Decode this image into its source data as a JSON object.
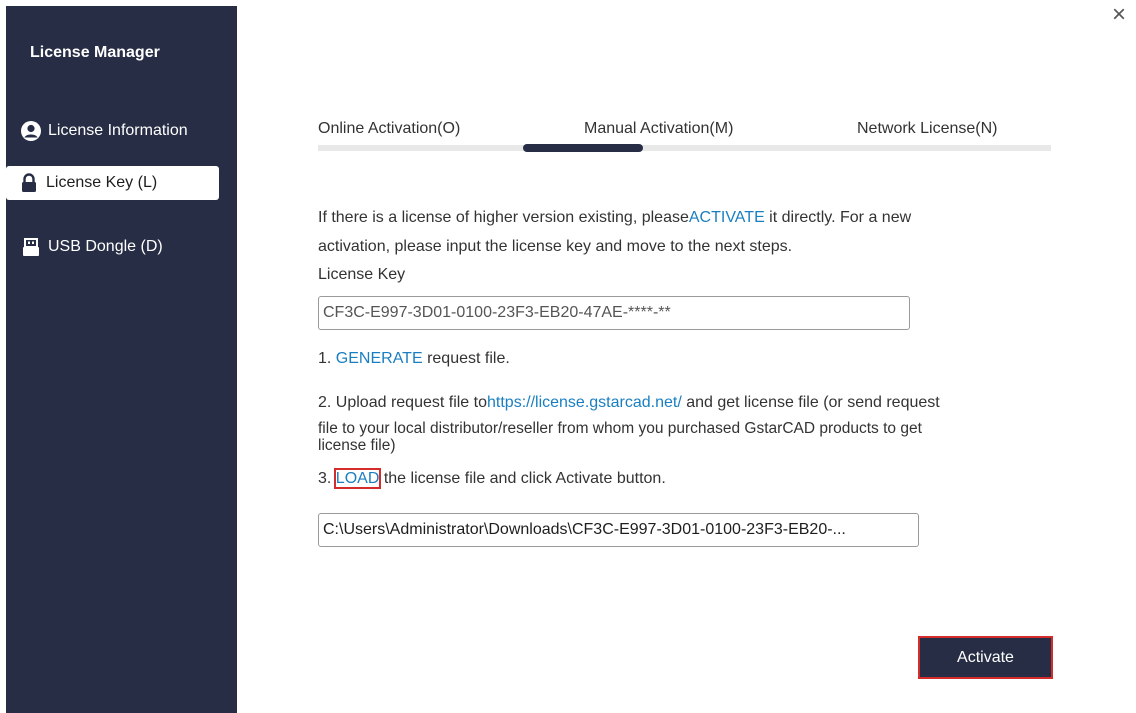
{
  "app": {
    "title": "License Manager",
    "close_glyph": "×"
  },
  "sidebar": {
    "items": [
      {
        "label": "License Information",
        "icon": "user-circle-icon",
        "active": false
      },
      {
        "label": "License Key (L)",
        "icon": "lock-icon",
        "active": true
      },
      {
        "label": "USB Dongle (D)",
        "icon": "usb-icon",
        "active": false
      }
    ]
  },
  "tabs": [
    {
      "label": "Online Activation(O)",
      "active": false
    },
    {
      "label": "Manual Activation(M)",
      "active": true
    },
    {
      "label": "Network License(N)",
      "active": false
    }
  ],
  "manual": {
    "intro_line1_pre": "If there is a license of higher version existing, please",
    "intro_line1_link": "ACTIVATE",
    "intro_line1_post": " it directly. For a new",
    "intro_line2": "activation, please input the license key and move to the next steps.",
    "license_key_label": "License Key",
    "license_key_value": "CF3C-E997-3D01-0100-23F3-EB20-47AE-****-**",
    "step1_pre": "1. ",
    "step1_link": "GENERATE",
    "step1_post": " request file.",
    "step2_pre": "2. Upload request file to",
    "step2_link": "https://license.gstarcad.net/",
    "step2_post": " and get license file (or send request",
    "step2_line2": "file to your local distributor/reseller from whom you purchased GstarCAD products to get",
    "step2_line3": "license file)",
    "step3_pre": "3. ",
    "step3_link": "LOAD",
    "step3_post": " the license file and click Activate button.",
    "license_file_path": "C:\\Users\\Administrator\\Downloads\\CF3C-E997-3D01-0100-23F3-EB20-..."
  },
  "buttons": {
    "activate": "Activate"
  },
  "colors": {
    "sidebar_bg": "#262d44",
    "link": "#1a7fc1",
    "highlight_box": "#d42b2b"
  }
}
